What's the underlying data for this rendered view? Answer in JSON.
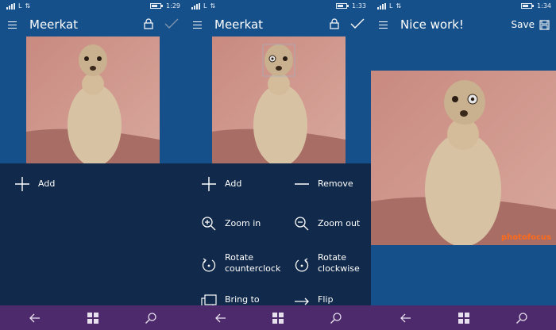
{
  "screens": [
    {
      "status": {
        "time": "1:29"
      },
      "header": {
        "title": "Meerkat"
      },
      "commands": [
        {
          "label": "Add"
        }
      ]
    },
    {
      "status": {
        "time": "1:33"
      },
      "header": {
        "title": "Meerkat"
      },
      "commands": [
        {
          "label": "Add"
        },
        {
          "label": "Remove"
        },
        {
          "label": "Zoom in"
        },
        {
          "label": "Zoom out"
        },
        {
          "label": "Rotate\ncounterclock"
        },
        {
          "label": "Rotate\nclockwise"
        },
        {
          "label": "Bring to"
        },
        {
          "label": "Flip"
        }
      ]
    },
    {
      "status": {
        "time": "1:34"
      },
      "header": {
        "title": "Nice work!",
        "save_label": "Save"
      },
      "watermark": "photofocus"
    }
  ],
  "icons": [
    "hamburger-icon",
    "lock-icon",
    "check-icon",
    "plus-icon",
    "minus-icon",
    "zoom-in-icon",
    "zoom-out-icon",
    "rotate-ccw-icon",
    "rotate-cw-icon",
    "layers-icon",
    "flip-arrow-icon",
    "back-icon",
    "windows-icon",
    "search-icon",
    "save-icon"
  ],
  "colors": {
    "accent_blue": "#16508a",
    "panel_navy": "#11294a",
    "nav_purple": "#4d2a6b",
    "watermark_orange": "#ff6a1a"
  }
}
